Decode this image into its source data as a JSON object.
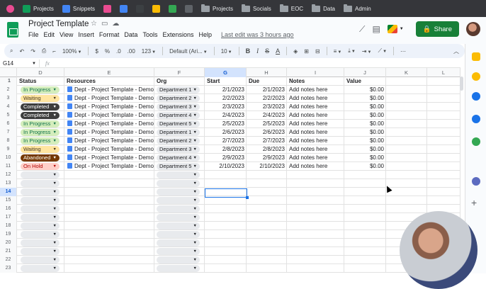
{
  "bookmarks": [
    {
      "label": "",
      "icon": "circle-icon",
      "color": "#e94b91"
    },
    {
      "label": "Projects",
      "icon": "sheets-icon",
      "color": "#0f9d58"
    },
    {
      "label": "Snippets",
      "icon": "docs-icon",
      "color": "#4285f4"
    },
    {
      "label": "",
      "icon": "app-icon",
      "color": "#e94b91"
    },
    {
      "label": "",
      "icon": "app-icon",
      "color": "#4285f4"
    },
    {
      "label": "",
      "icon": "app-icon",
      "color": "#3c4043"
    },
    {
      "label": "",
      "icon": "drive-icon",
      "color": "#fbbc04"
    },
    {
      "label": "",
      "icon": "app-icon",
      "color": "#34a853"
    },
    {
      "label": "",
      "icon": "app-icon",
      "color": "#5f6368"
    },
    {
      "label": "Projects",
      "icon": "folder-icon",
      "color": "#9aa0a6"
    },
    {
      "label": "Socials",
      "icon": "folder-icon",
      "color": "#9aa0a6"
    },
    {
      "label": "EOC",
      "icon": "folder-icon",
      "color": "#9aa0a6"
    },
    {
      "label": "Data",
      "icon": "folder-icon",
      "color": "#9aa0a6"
    },
    {
      "label": "Admin",
      "icon": "folder-icon",
      "color": "#9aa0a6"
    }
  ],
  "doc": {
    "title": "Project Template",
    "last_edit": "Last edit was 3 hours ago"
  },
  "menu": [
    "File",
    "Edit",
    "View",
    "Insert",
    "Format",
    "Data",
    "Tools",
    "Extensions",
    "Help"
  ],
  "share_label": "Share",
  "toolbar": {
    "zoom": "100%",
    "currency": "$",
    "percent": "%",
    "dec_decrease": ".0",
    "dec_increase": ".00",
    "more_formats": "123",
    "font": "Default (Ari...",
    "font_size": "10",
    "bold": "B",
    "italic": "I",
    "strike": "S",
    "text_color": "A"
  },
  "formula_bar": {
    "cell_ref": "G14",
    "fx": "fx",
    "value": ""
  },
  "columns": [
    "D",
    "E",
    "F",
    "G",
    "H",
    "I",
    "J",
    "K",
    "L"
  ],
  "headers": {
    "status": "Status",
    "resources": "Resources",
    "org": "Org",
    "start": "Start",
    "due": "Due",
    "notes": "Notes",
    "value": "Value"
  },
  "rows": [
    {
      "num": "2",
      "status": "In Progress",
      "status_bg": "#d4edbc",
      "status_fg": "#11734b",
      "resource": "Dept - Project Template - Demo",
      "org": "Department 1",
      "start": "2/1/2023",
      "due": "2/1/2023",
      "notes": "Add notes here",
      "value": "$0.00"
    },
    {
      "num": "3",
      "status": "Waiting",
      "status_bg": "#ffe5a0",
      "status_fg": "#473821",
      "resource": "Dept - Project Template - Demo",
      "org": "Department 2",
      "start": "2/2/2023",
      "due": "2/2/2023",
      "notes": "Add notes here",
      "value": "$0.00"
    },
    {
      "num": "4",
      "status": "Completed",
      "status_bg": "#3d3d3d",
      "status_fg": "#ffffff",
      "resource": "Dept - Project Template - Demo",
      "org": "Department 3",
      "start": "2/3/2023",
      "due": "2/3/2023",
      "notes": "Add notes here",
      "value": "$0.00"
    },
    {
      "num": "5",
      "status": "Completed",
      "status_bg": "#3d3d3d",
      "status_fg": "#ffffff",
      "resource": "Dept - Project Template - Demo",
      "org": "Department 4",
      "start": "2/4/2023",
      "due": "2/4/2023",
      "notes": "Add notes here",
      "value": "$0.00"
    },
    {
      "num": "6",
      "status": "In Progress",
      "status_bg": "#d4edbc",
      "status_fg": "#11734b",
      "resource": "Dept - Project Template - Demo",
      "org": "Department 5",
      "start": "2/5/2023",
      "due": "2/5/2023",
      "notes": "Add notes here",
      "value": "$0.00"
    },
    {
      "num": "7",
      "status": "In Progress",
      "status_bg": "#d4edbc",
      "status_fg": "#11734b",
      "resource": "Dept - Project Template - Demo",
      "org": "Department 1",
      "start": "2/6/2023",
      "due": "2/6/2023",
      "notes": "Add notes here",
      "value": "$0.00"
    },
    {
      "num": "8",
      "status": "In Progress",
      "status_bg": "#d4edbc",
      "status_fg": "#11734b",
      "resource": "Dept - Project Template - Demo",
      "org": "Department 2",
      "start": "2/7/2023",
      "due": "2/7/2023",
      "notes": "Add notes here",
      "value": "$0.00"
    },
    {
      "num": "9",
      "status": "Waiting",
      "status_bg": "#ffe5a0",
      "status_fg": "#473821",
      "resource": "Dept - Project Template - Demo",
      "org": "Department 3",
      "start": "2/8/2023",
      "due": "2/8/2023",
      "notes": "Add notes here",
      "value": "$0.00"
    },
    {
      "num": "10",
      "status": "Abandoned",
      "status_bg": "#753800",
      "status_fg": "#ffffff",
      "resource": "Dept - Project Template - Demo",
      "org": "Department 4",
      "start": "2/9/2023",
      "due": "2/9/2023",
      "notes": "Add notes here",
      "value": "$0.00"
    },
    {
      "num": "11",
      "status": "On Hold",
      "status_bg": "#ffcfc9",
      "status_fg": "#b10202",
      "resource": "Dept - Project Template - Demo",
      "org": "Department 5",
      "start": "2/10/2023",
      "due": "2/10/2023",
      "notes": "Add notes here",
      "value": "$0.00"
    }
  ],
  "empty_rows": [
    "12",
    "13",
    "14",
    "15",
    "16",
    "17",
    "18",
    "19",
    "20",
    "21",
    "22",
    "23"
  ],
  "selected_row": "14",
  "selected_col": "G"
}
